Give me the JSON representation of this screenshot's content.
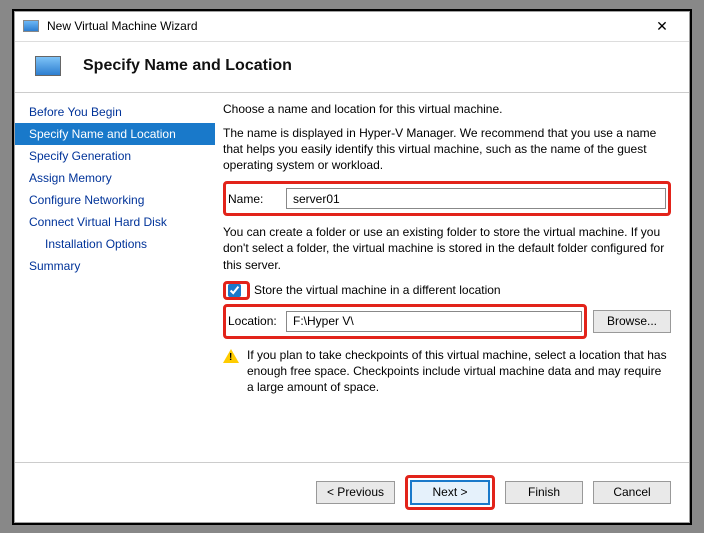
{
  "title": "New Virtual Machine Wizard",
  "header": "Specify Name and Location",
  "sidebar": {
    "items": [
      "Before You Begin",
      "Specify Name and Location",
      "Specify Generation",
      "Assign Memory",
      "Configure Networking",
      "Connect Virtual Hard Disk",
      "Installation Options",
      "Summary"
    ],
    "activeIndex": 1,
    "subIndex": 6
  },
  "content": {
    "intro": "Choose a name and location for this virtual machine.",
    "name_help": "The name is displayed in Hyper-V Manager. We recommend that you use a name that helps you easily identify this virtual machine, such as the name of the guest operating system or workload.",
    "name_label": "Name:",
    "name_value": "server01",
    "location_help": "You can create a folder or use an existing folder to store the virtual machine. If you don't select a folder, the virtual machine is stored in the default folder configured for this server.",
    "store_chk_label": "Store the virtual machine in a different location",
    "store_chk_checked": true,
    "location_label": "Location:",
    "location_value": "F:\\Hyper V\\",
    "browse_label": "Browse...",
    "warn": "If you plan to take checkpoints of this virtual machine, select a location that has enough free space. Checkpoints include virtual machine data and may require a large amount of space."
  },
  "footer": {
    "previous": "< Previous",
    "next": "Next >",
    "finish": "Finish",
    "cancel": "Cancel"
  }
}
